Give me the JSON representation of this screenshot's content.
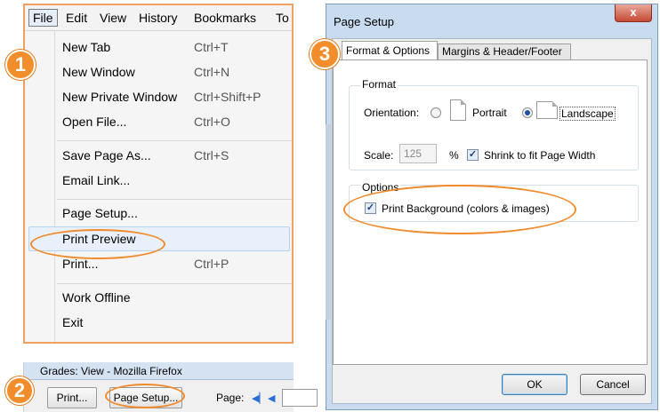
{
  "menubar": {
    "items": [
      "File",
      "Edit",
      "View",
      "History",
      "Bookmarks",
      "To"
    ]
  },
  "file_menu": {
    "items": [
      {
        "label": "New Tab",
        "shortcut": "Ctrl+T"
      },
      {
        "label": "New Window",
        "shortcut": "Ctrl+N"
      },
      {
        "label": "New Private Window",
        "shortcut": "Ctrl+Shift+P"
      },
      {
        "label": "Open File...",
        "shortcut": "Ctrl+O"
      },
      {
        "label": "Save Page As...",
        "shortcut": "Ctrl+S"
      },
      {
        "label": "Email Link...",
        "shortcut": ""
      },
      {
        "label": "Page Setup...",
        "shortcut": ""
      },
      {
        "label": "Print Preview",
        "shortcut": ""
      },
      {
        "label": "Print...",
        "shortcut": "Ctrl+P"
      },
      {
        "label": "Work Offline",
        "shortcut": ""
      },
      {
        "label": "Exit",
        "shortcut": ""
      }
    ]
  },
  "toolbar": {
    "window_title": "Grades: View - Mozilla Firefox",
    "print_label": "Print...",
    "page_setup_label": "Page Setup...",
    "page_label": "Page:",
    "first_icon": "first-page-icon",
    "prev_icon": "prev-page-icon"
  },
  "dialog": {
    "title": "Page Setup",
    "close_glyph": "x",
    "tabs": [
      "Format & Options",
      "Margins & Header/Footer"
    ],
    "format_group": "Format",
    "orientation_label": "Orientation:",
    "portrait_label": "Portrait",
    "landscape_label": "Landscape",
    "orientation_selected": "Landscape",
    "scale_label": "Scale:",
    "scale_value": "125",
    "percent": "%",
    "shrink_label": "Shrink to fit Page Width",
    "shrink_checked": true,
    "options_group": "Options",
    "print_bg_label": "Print Background (colors & images)",
    "print_bg_checked": true,
    "ok_label": "OK",
    "cancel_label": "Cancel"
  },
  "badges": [
    "1",
    "2",
    "3"
  ],
  "colors": {
    "accent_orange": "#f28d2c",
    "highlight_blue": "#e8f0fb",
    "dialog_frame": "#c9dcef"
  }
}
